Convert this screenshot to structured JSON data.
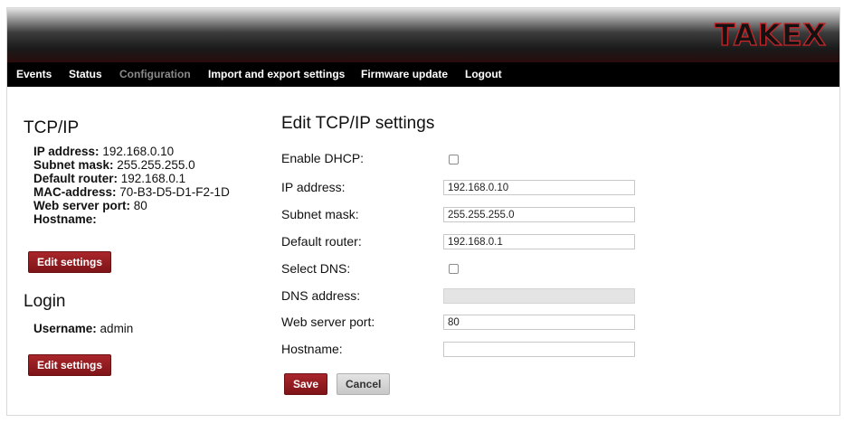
{
  "brand": {
    "logo_text": "TAKEX"
  },
  "nav": {
    "items": [
      {
        "label": "Events",
        "active": false
      },
      {
        "label": "Status",
        "active": false
      },
      {
        "label": "Configuration",
        "active": true
      },
      {
        "label": "Import and export settings",
        "active": false
      },
      {
        "label": "Firmware update",
        "active": false
      },
      {
        "label": "Logout",
        "active": false
      }
    ]
  },
  "tcpip": {
    "title": "TCP/IP",
    "ip": {
      "label": "IP address:",
      "value": "192.168.0.10"
    },
    "subnet": {
      "label": "Subnet mask:",
      "value": "255.255.255.0"
    },
    "router": {
      "label": "Default router:",
      "value": "192.168.0.1"
    },
    "mac": {
      "label": "MAC-address:",
      "value": "70-B3-D5-D1-F2-1D"
    },
    "port": {
      "label": "Web server port:",
      "value": "80"
    },
    "hostname": {
      "label": "Hostname:",
      "value": ""
    },
    "edit_label": "Edit settings"
  },
  "login": {
    "title": "Login",
    "username": {
      "label": "Username:",
      "value": "admin"
    },
    "edit_label": "Edit settings"
  },
  "form": {
    "title": "Edit TCP/IP settings",
    "enable_dhcp": {
      "label": "Enable DHCP:",
      "checked": false
    },
    "ip_address": {
      "label": "IP address:",
      "value": "192.168.0.10"
    },
    "subnet_mask": {
      "label": "Subnet mask:",
      "value": "255.255.255.0"
    },
    "default_router": {
      "label": "Default router:",
      "value": "192.168.0.1"
    },
    "select_dns": {
      "label": "Select DNS:",
      "checked": false
    },
    "dns_address": {
      "label": "DNS address:",
      "value": "",
      "disabled": true
    },
    "web_server_port": {
      "label": "Web server port:",
      "value": "80"
    },
    "hostname": {
      "label": "Hostname:",
      "value": ""
    },
    "save_label": "Save",
    "cancel_label": "Cancel"
  },
  "colors": {
    "accent_red": "#8f1b1f",
    "menubar_bg": "#000000",
    "active_nav_text": "#8a8a8a",
    "logo_outline": "#c4262a"
  }
}
